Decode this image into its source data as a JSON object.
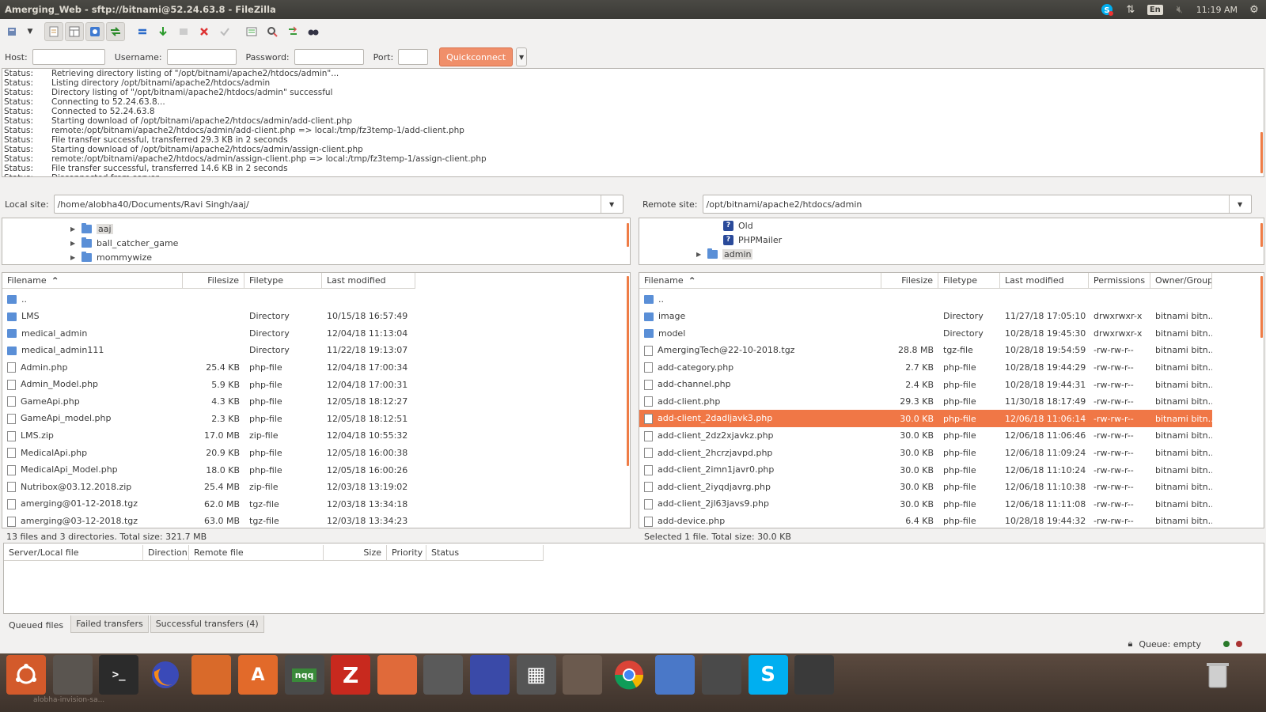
{
  "window": {
    "title": "Amerging_Web - sftp://bitnami@52.24.63.8 - FileZilla"
  },
  "tray": {
    "lang": "En",
    "clock": "11:19 AM",
    "icons": [
      "skype-icon",
      "network-icon",
      "volume-mute-icon",
      "settings-gear-icon"
    ]
  },
  "toolbar": {
    "icons": [
      "site-manager-icon",
      "dropdown-icon",
      "message-log-icon",
      "local-tree-icon",
      "remote-tree-icon",
      "transfer-queue-icon",
      "refresh-icon",
      "process-queue-icon",
      "cancel-icon",
      "disconnect-icon",
      "reconnect-icon",
      "directory-listing-filter-icon",
      "toggle-filters-icon",
      "sync-browse-icon",
      "search-icon"
    ]
  },
  "quickconnect": {
    "host_label": "Host:",
    "host_value": "",
    "username_label": "Username:",
    "username_value": "",
    "password_label": "Password:",
    "password_value": "",
    "port_label": "Port:",
    "port_value": "",
    "button": "Quickconnect"
  },
  "log": [
    {
      "s": "Status:",
      "m": "Retrieving directory listing of \"/opt/bitnami/apache2/htdocs/admin\"..."
    },
    {
      "s": "Status:",
      "m": "Listing directory /opt/bitnami/apache2/htdocs/admin"
    },
    {
      "s": "Status:",
      "m": "Directory listing of \"/opt/bitnami/apache2/htdocs/admin\" successful"
    },
    {
      "s": "Status:",
      "m": "Connecting to 52.24.63.8..."
    },
    {
      "s": "Status:",
      "m": "Connected to 52.24.63.8"
    },
    {
      "s": "Status:",
      "m": "Starting download of /opt/bitnami/apache2/htdocs/admin/add-client.php"
    },
    {
      "s": "Status:",
      "m": "remote:/opt/bitnami/apache2/htdocs/admin/add-client.php => local:/tmp/fz3temp-1/add-client.php"
    },
    {
      "s": "Status:",
      "m": "File transfer successful, transferred 29.3 KB in 2 seconds"
    },
    {
      "s": "Status:",
      "m": "Starting download of /opt/bitnami/apache2/htdocs/admin/assign-client.php"
    },
    {
      "s": "Status:",
      "m": "remote:/opt/bitnami/apache2/htdocs/admin/assign-client.php => local:/tmp/fz3temp-1/assign-client.php"
    },
    {
      "s": "Status:",
      "m": "File transfer successful, transferred 14.6 KB in 2 seconds"
    },
    {
      "s": "Status:",
      "m": "Disconnected from server"
    }
  ],
  "local": {
    "site_label": "Local site:",
    "path": "/home/alobha40/Documents/Ravi Singh/aaj/",
    "tree": [
      "aaj",
      "ball_catcher_game",
      "mommywize"
    ],
    "headers": [
      "Filename",
      "Filesize",
      "Filetype",
      "Last modified"
    ],
    "files": [
      {
        "name": "..",
        "size": "",
        "type": "",
        "mod": "",
        "kind": "dir"
      },
      {
        "name": "LMS",
        "size": "",
        "type": "Directory",
        "mod": "10/15/18 16:57:49",
        "kind": "dir"
      },
      {
        "name": "medical_admin",
        "size": "",
        "type": "Directory",
        "mod": "12/04/18 11:13:04",
        "kind": "dir"
      },
      {
        "name": "medical_admin111",
        "size": "",
        "type": "Directory",
        "mod": "11/22/18 19:13:07",
        "kind": "dir"
      },
      {
        "name": "Admin.php",
        "size": "25.4 KB",
        "type": "php-file",
        "mod": "12/04/18 17:00:34",
        "kind": "file"
      },
      {
        "name": "Admin_Model.php",
        "size": "5.9 KB",
        "type": "php-file",
        "mod": "12/04/18 17:00:31",
        "kind": "file"
      },
      {
        "name": "GameApi.php",
        "size": "4.3 KB",
        "type": "php-file",
        "mod": "12/05/18 18:12:27",
        "kind": "file"
      },
      {
        "name": "GameApi_model.php",
        "size": "2.3 KB",
        "type": "php-file",
        "mod": "12/05/18 18:12:51",
        "kind": "file"
      },
      {
        "name": "LMS.zip",
        "size": "17.0 MB",
        "type": "zip-file",
        "mod": "12/04/18 10:55:32",
        "kind": "file"
      },
      {
        "name": "MedicalApi.php",
        "size": "20.9 KB",
        "type": "php-file",
        "mod": "12/05/18 16:00:38",
        "kind": "file"
      },
      {
        "name": "MedicalApi_Model.php",
        "size": "18.0 KB",
        "type": "php-file",
        "mod": "12/05/18 16:00:26",
        "kind": "file"
      },
      {
        "name": "Nutribox@03.12.2018.zip",
        "size": "25.4 MB",
        "type": "zip-file",
        "mod": "12/03/18 13:19:02",
        "kind": "file"
      },
      {
        "name": "amerging@01-12-2018.tgz",
        "size": "62.0 MB",
        "type": "tgz-file",
        "mod": "12/03/18 13:34:18",
        "kind": "file"
      },
      {
        "name": "amerging@03-12-2018.tgz",
        "size": "63.0 MB",
        "type": "tgz-file",
        "mod": "12/03/18 13:34:23",
        "kind": "file"
      }
    ],
    "status": "13 files and 3 directories. Total size: 321.7 MB"
  },
  "remote": {
    "site_label": "Remote site:",
    "path": "/opt/bitnami/apache2/htdocs/admin",
    "tree": [
      "Old",
      "PHPMailer",
      "admin"
    ],
    "headers": [
      "Filename",
      "Filesize",
      "Filetype",
      "Last modified",
      "Permissions",
      "Owner/Group"
    ],
    "files": [
      {
        "name": "..",
        "size": "",
        "type": "",
        "mod": "",
        "perm": "",
        "owner": "",
        "kind": "dir"
      },
      {
        "name": "image",
        "size": "",
        "type": "Directory",
        "mod": "11/27/18 17:05:10",
        "perm": "drwxrwxr-x",
        "owner": "bitnami bitn...",
        "kind": "dir"
      },
      {
        "name": "model",
        "size": "",
        "type": "Directory",
        "mod": "10/28/18 19:45:30",
        "perm": "drwxrwxr-x",
        "owner": "bitnami bitn...",
        "kind": "dir"
      },
      {
        "name": "AmergingTech@22-10-2018.tgz",
        "size": "28.8 MB",
        "type": "tgz-file",
        "mod": "10/28/18 19:54:59",
        "perm": "-rw-rw-r--",
        "owner": "bitnami bitn...",
        "kind": "file"
      },
      {
        "name": "add-category.php",
        "size": "2.7 KB",
        "type": "php-file",
        "mod": "10/28/18 19:44:29",
        "perm": "-rw-rw-r--",
        "owner": "bitnami bitn...",
        "kind": "file"
      },
      {
        "name": "add-channel.php",
        "size": "2.4 KB",
        "type": "php-file",
        "mod": "10/28/18 19:44:31",
        "perm": "-rw-rw-r--",
        "owner": "bitnami bitn...",
        "kind": "file"
      },
      {
        "name": "add-client.php",
        "size": "29.3 KB",
        "type": "php-file",
        "mod": "11/30/18 18:17:49",
        "perm": "-rw-rw-r--",
        "owner": "bitnami bitn...",
        "kind": "file"
      },
      {
        "name": "add-client_2dadljavk3.php",
        "size": "30.0 KB",
        "type": "php-file",
        "mod": "12/06/18 11:06:14",
        "perm": "-rw-rw-r--",
        "owner": "bitnami bitn...",
        "kind": "file",
        "selected": true
      },
      {
        "name": "add-client_2dz2xjavkz.php",
        "size": "30.0 KB",
        "type": "php-file",
        "mod": "12/06/18 11:06:46",
        "perm": "-rw-rw-r--",
        "owner": "bitnami bitn...",
        "kind": "file"
      },
      {
        "name": "add-client_2hcrzjavpd.php",
        "size": "30.0 KB",
        "type": "php-file",
        "mod": "12/06/18 11:09:24",
        "perm": "-rw-rw-r--",
        "owner": "bitnami bitn...",
        "kind": "file"
      },
      {
        "name": "add-client_2imn1javr0.php",
        "size": "30.0 KB",
        "type": "php-file",
        "mod": "12/06/18 11:10:24",
        "perm": "-rw-rw-r--",
        "owner": "bitnami bitn...",
        "kind": "file"
      },
      {
        "name": "add-client_2iyqdjavrg.php",
        "size": "30.0 KB",
        "type": "php-file",
        "mod": "12/06/18 11:10:38",
        "perm": "-rw-rw-r--",
        "owner": "bitnami bitn...",
        "kind": "file"
      },
      {
        "name": "add-client_2jl63javs9.php",
        "size": "30.0 KB",
        "type": "php-file",
        "mod": "12/06/18 11:11:08",
        "perm": "-rw-rw-r--",
        "owner": "bitnami bitn...",
        "kind": "file"
      },
      {
        "name": "add-device.php",
        "size": "6.4 KB",
        "type": "php-file",
        "mod": "10/28/18 19:44:32",
        "perm": "-rw-rw-r--",
        "owner": "bitnami bitn...",
        "kind": "file"
      }
    ],
    "status": "Selected 1 file. Total size: 30.0 KB"
  },
  "queue": {
    "headers": [
      "Server/Local file",
      "Direction",
      "Remote file",
      "Size",
      "Priority",
      "Status"
    ],
    "tabs": [
      "Queued files",
      "Failed transfers",
      "Successful transfers (4)"
    ],
    "status": "Queue: empty"
  },
  "launcher": {
    "items": [
      "ubuntu-dash-icon",
      "files-icon",
      "terminal-icon",
      "firefox-icon",
      "text-editor-icon",
      "software-center-icon",
      "nqq-icon",
      "filezilla-icon",
      "pencil-app-icon",
      "screenshot-icon",
      "remote-desktop-icon",
      "calculator-icon",
      "inkscape-icon",
      "chrome-icon",
      "chromium-icon",
      "video-icon",
      "skype-icon",
      "sublime-icon",
      "trash-icon"
    ],
    "nqq_label": "nqq",
    "user_text": "alobha-invision-sa..."
  },
  "colors": {
    "accent": "#f07746",
    "quickconnect": "#f08f6a",
    "folder": "#5a8fd7"
  }
}
